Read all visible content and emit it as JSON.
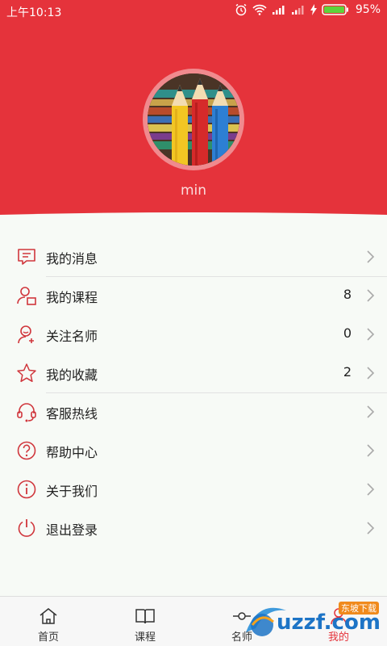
{
  "status_bar": {
    "time": "上午10:13",
    "battery": "95%",
    "icons": [
      "alarm-icon",
      "wifi-icon",
      "signal-icon",
      "signal-weak-icon",
      "charging-icon",
      "battery-icon"
    ]
  },
  "profile": {
    "username": "min",
    "avatar": "colored-pencils-photo"
  },
  "menu": {
    "items": [
      {
        "label": "我的消息",
        "count": "",
        "icon": "message-icon"
      },
      {
        "label": "我的课程",
        "count": "8",
        "icon": "course-user-icon"
      },
      {
        "label": "关注名师",
        "count": "0",
        "icon": "follow-teacher-icon"
      },
      {
        "label": "我的收藏",
        "count": "2",
        "icon": "star-icon"
      },
      {
        "label": "客服热线",
        "count": "",
        "icon": "headset-icon"
      },
      {
        "label": "帮助中心",
        "count": "",
        "icon": "help-icon"
      },
      {
        "label": "关于我们",
        "count": "",
        "icon": "info-icon"
      },
      {
        "label": "退出登录",
        "count": "",
        "icon": "power-icon"
      }
    ]
  },
  "tabbar": {
    "tabs": [
      {
        "label": "首页",
        "icon": "home-icon"
      },
      {
        "label": "课程",
        "icon": "book-icon"
      },
      {
        "label": "名师",
        "icon": "teacher-icon"
      },
      {
        "label": "我的",
        "icon": "me-icon",
        "active": true
      }
    ]
  },
  "watermark": {
    "text": "uzzf.com",
    "subtext": "东坡下载"
  },
  "colors": {
    "accent": "#e5333b",
    "background": "#f7faf6",
    "icon_red": "#d0363c"
  }
}
